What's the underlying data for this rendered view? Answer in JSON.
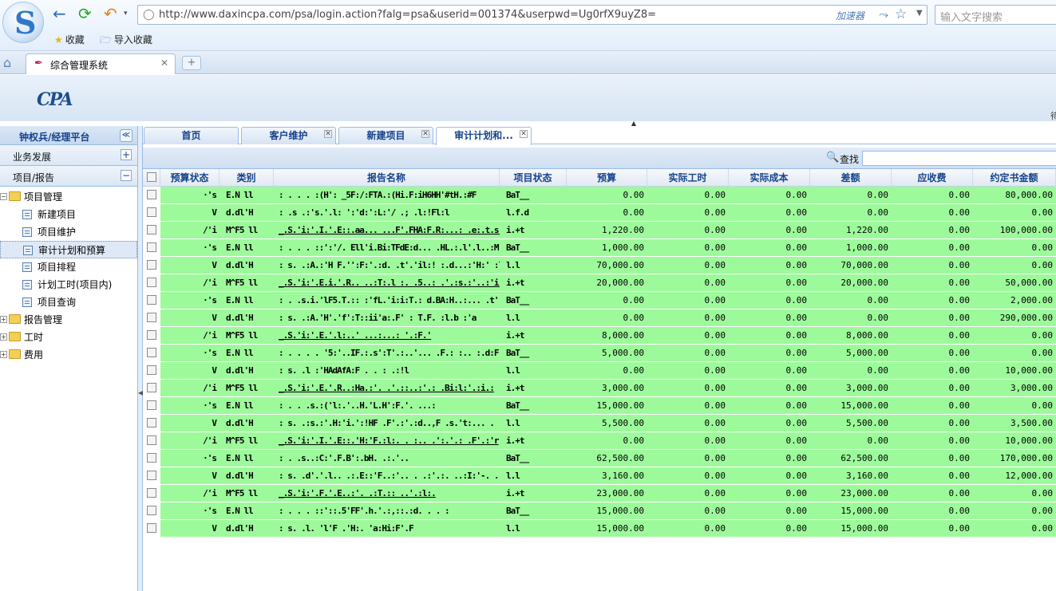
{
  "browser": {
    "url": "http://www.daxincpa.com/psa/login.action?falg=psa&userid=001374&userpwd=Ug0rfX9uyZ8=",
    "accelerator_label": "加速器",
    "search_placeholder": "输入文字搜索",
    "favorites_label": "收藏",
    "import_favorites_label": "导入收藏",
    "tab_title": "综合管理系统",
    "icons": [
      "back-arrow-icon",
      "refresh-icon",
      "undo-icon",
      "shield-icon",
      "lightning-icon",
      "star-icon",
      "home-icon"
    ]
  },
  "app": {
    "logo_text": "CPA",
    "header_right": "待"
  },
  "sidebar": {
    "title": "钟权兵/经理平台",
    "collapse_symbol": "≪",
    "sections": [
      {
        "label": "业务发展",
        "toggle": "+"
      },
      {
        "label": "项目/报告",
        "toggle": "−"
      }
    ],
    "tree": {
      "root": "项目管理",
      "children": [
        "新建项目",
        "项目维护",
        "审计计划和预算",
        "项目排程",
        "计划工时(项目内)",
        "项目查询"
      ],
      "selected": "审计计划和预算",
      "others": [
        "报告管理",
        "工时",
        "费用"
      ]
    }
  },
  "tabs": [
    {
      "label": "首页",
      "closable": false
    },
    {
      "label": "客户维护",
      "closable": true
    },
    {
      "label": "新建项目",
      "closable": true
    },
    {
      "label": "审计计划和...",
      "closable": true,
      "active": true
    }
  ],
  "toolbar": {
    "search_label": "查找"
  },
  "grid": {
    "columns": [
      "预算状态",
      "类别",
      "报告名称",
      "项目状态",
      "预算",
      "实际工时",
      "实际成本",
      "差额",
      "应收费",
      "约定书金额"
    ],
    "rows": [
      {
        "status": "·'s",
        "cat": "E.N ll",
        "name": ": . . . :(H': _5F:/:FTA.:(Hi.F:iH6HH'#tH.:#F",
        "pstat": "BaT__",
        "budget": "0.00",
        "hours": "0.00",
        "cost": "0.00",
        "diff": "0.00",
        "recv": "0.00",
        "contract": "80,000.00"
      },
      {
        "status": "V",
        "cat": "d.dl'H",
        "name": ": .s .:'s.'.l: ':'d:':L:'/ .; .l:!Fl:l",
        "pstat": "l.f.d",
        "budget": "0.00",
        "hours": "0.00",
        "cost": "0.00",
        "diff": "0.00",
        "recv": "0.00",
        "contract": "0.00"
      },
      {
        "status": "/'i",
        "cat": "M^F5 ll",
        "name": "_.S.'i:'.I.'.E::.aa... ...F'.FHA:F.R:...: .e:.t.s'.T .:... .:",
        "pstat": "i.+t",
        "budget": "1,220.00",
        "hours": "0.00",
        "cost": "0.00",
        "diff": "1,220.00",
        "recv": "0.00",
        "contract": "100,000.00"
      },
      {
        "status": "·'s",
        "cat": "E.N ll",
        "name": ": . . . ::':'/. Ell'i.Bi:TFdE:d... .HL.:.l'.l..:M:",
        "pstat": "BaT__",
        "budget": "1,000.00",
        "hours": "0.00",
        "cost": "0.00",
        "diff": "1,000.00",
        "recv": "0.00",
        "contract": "0.00"
      },
      {
        "status": "V",
        "cat": "d.dl'H",
        "name": ": s. .:A.:'H F.'':F:'.:d. .t'.'il:! :.d...:'H:' :l",
        "pstat": "l.l",
        "budget": "70,000.00",
        "hours": "0.00",
        "cost": "0.00",
        "diff": "70,000.00",
        "recv": "0.00",
        "contract": "0.00"
      },
      {
        "status": "/'i",
        "cat": "M^F5 ll",
        "name": "_.S.'i:'.E.i.'.R.. ..:T:.l :. .5..: .'.:s.:'..:'i:/",
        "pstat": "i.+t",
        "budget": "20,000.00",
        "hours": "0.00",
        "cost": "0.00",
        "diff": "20,000.00",
        "recv": "0.00",
        "contract": "50,000.00"
      },
      {
        "status": "·'s",
        "cat": "E.N ll",
        "name": ": . .s.i.'lF5.T.:: :'fL.'i:i:T.: d.BA:H..:... .t'.. .",
        "pstat": "BaT__",
        "budget": "0.00",
        "hours": "0.00",
        "cost": "0.00",
        "diff": "0.00",
        "recv": "0.00",
        "contract": "2,000.00"
      },
      {
        "status": "V",
        "cat": "d.dl'H",
        "name": ": s. .:A.'H'.'f':T::ii'a:.F' : T.F. :l.b :'a",
        "pstat": "l.l",
        "budget": "0.00",
        "hours": "0.00",
        "cost": "0.00",
        "diff": "0.00",
        "recv": "0.00",
        "contract": "290,000.00"
      },
      {
        "status": "/'i",
        "cat": "M^F5 ll",
        "name": "_.S.'i:'.E.'.l:..' ...:...: '.:F.'",
        "pstat": "i.+t",
        "budget": "8,000.00",
        "hours": "0.00",
        "cost": "0.00",
        "diff": "8,000.00",
        "recv": "0.00",
        "contract": "0.00"
      },
      {
        "status": "·'s",
        "cat": "E.N ll",
        "name": ": . . . . '5:'..IF.:.s':T'.:..'... .F.: :.. :.d:F",
        "pstat": "BaT__",
        "budget": "5,000.00",
        "hours": "0.00",
        "cost": "0.00",
        "diff": "5,000.00",
        "recv": "0.00",
        "contract": "0.00"
      },
      {
        "status": "V",
        "cat": "d.dl'H",
        "name": ": s. .l :'HAdAfA:F . . : .:!l",
        "pstat": "l.l",
        "budget": "0.00",
        "hours": "0.00",
        "cost": "0.00",
        "diff": "0.00",
        "recv": "0.00",
        "contract": "10,000.00"
      },
      {
        "status": "/'i",
        "cat": "M^F5 ll",
        "name": "_.S.'i:'.E.'.R..:Ha.:'. .'.::..:'.: .Bi:l:'.:i.:",
        "pstat": "i.+t",
        "budget": "3,000.00",
        "hours": "0.00",
        "cost": "0.00",
        "diff": "3,000.00",
        "recv": "0.00",
        "contract": "3,000.00"
      },
      {
        "status": "·'s",
        "cat": "E.N ll",
        "name": ": . . .s.:('l:.'..H.'L.H':F.'. ...:",
        "pstat": "BaT__",
        "budget": "15,000.00",
        "hours": "0.00",
        "cost": "0.00",
        "diff": "15,000.00",
        "recv": "0.00",
        "contract": "0.00"
      },
      {
        "status": "V",
        "cat": "d.dl'H",
        "name": ": s. .:s.:'.H:'i.':!HF .F'.:'.:d..,F .s.'t:... .",
        "pstat": "l.l",
        "budget": "5,500.00",
        "hours": "0.00",
        "cost": "0.00",
        "diff": "5,500.00",
        "recv": "0.00",
        "contract": "3,500.00"
      },
      {
        "status": "/'i",
        "cat": "M^F5 ll",
        "name": "_.S.'i:'.I.'.E::.'H:'F.:l:. . :.. .':.'.: .F'.:'r",
        "pstat": "i.+t",
        "budget": "0.00",
        "hours": "0.00",
        "cost": "0.00",
        "diff": "0.00",
        "recv": "0.00",
        "contract": "10,000.00"
      },
      {
        "status": "·'s",
        "cat": "E.N ll",
        "name": ": . .s..:C:'.F.B':.bH. .:.'..",
        "pstat": "BaT__",
        "budget": "62,500.00",
        "hours": "0.00",
        "cost": "0.00",
        "diff": "62,500.00",
        "recv": "0.00",
        "contract": "170,000.00"
      },
      {
        "status": "V",
        "cat": "d.dl'H",
        "name": ": s. .d'.'.l.. .:.E::'F..:'.. . .:'.:. ..:I:'-. . . .",
        "pstat": "l.l",
        "budget": "3,160.00",
        "hours": "0.00",
        "cost": "0.00",
        "diff": "3,160.00",
        "recv": "0.00",
        "contract": "12,000.00"
      },
      {
        "status": "/'i",
        "cat": "M^F5 ll",
        "name": "_.S.'i:'.F.'.E..:'. .:T.:: ..'.:l:.",
        "pstat": "i.+t",
        "budget": "23,000.00",
        "hours": "0.00",
        "cost": "0.00",
        "diff": "23,000.00",
        "recv": "0.00",
        "contract": "0.00"
      },
      {
        "status": "·'s",
        "cat": "E.N ll",
        "name": ": . . . ::'::.5'FF'.h.'.:,::.:d. . . :",
        "pstat": "BaT__",
        "budget": "15,000.00",
        "hours": "0.00",
        "cost": "0.00",
        "diff": "15,000.00",
        "recv": "0.00",
        "contract": "0.00"
      },
      {
        "status": "V",
        "cat": "d.dl'H",
        "name": ": s. .l. 'l'F .'H:. 'a:Hi:F'.F",
        "pstat": "l.l",
        "budget": "15,000.00",
        "hours": "0.00",
        "cost": "0.00",
        "diff": "15,000.00",
        "recv": "0.00",
        "contract": "0.00"
      }
    ]
  }
}
